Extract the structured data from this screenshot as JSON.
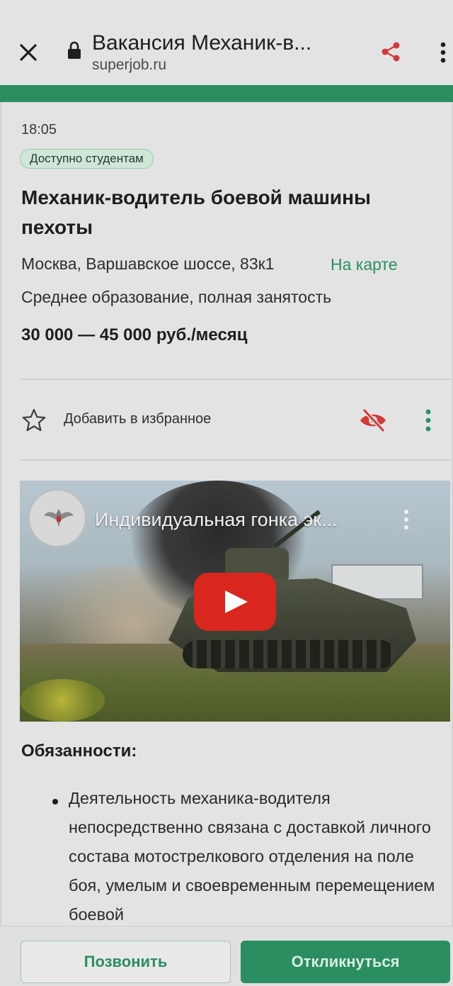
{
  "browser": {
    "tab_title": "Вакансия Механик-в...",
    "url": "superjob.ru"
  },
  "vacancy": {
    "time": "18:05",
    "badge": "Доступно студентам",
    "title": "Механик-водитель боевой машины пехоты",
    "address": "Москва, Варшавское шоссе, 83к1",
    "map_link": "На карте",
    "conditions": "Среднее образование, полная занятость",
    "salary": "30 000 — 45 000 руб./месяц"
  },
  "actions": {
    "favorite_label": "Добавить в избранное"
  },
  "video": {
    "title": "Индивидуальная гонка эк..."
  },
  "duties": {
    "heading": "Обязанности:",
    "items": [
      "Деятельность механика-водителя непосредственно связана с доставкой личного состава мотострелкового отделения на поле боя, умелым и своевременным перемещением боевой"
    ]
  },
  "bottom": {
    "call_label": "Позвонить",
    "apply_label": "Откликнуться"
  },
  "colors": {
    "accent": "#2a8e60",
    "hide_icon": "#d33a3a",
    "background": "#e3e3e3"
  },
  "icons": {
    "close": "close-icon",
    "lock": "lock-icon",
    "share": "share-icon",
    "menu": "kebab-menu-icon",
    "favorite": "star-icon",
    "hide": "eye-off-icon",
    "more": "kebab-menu-icon",
    "play": "play-icon"
  }
}
